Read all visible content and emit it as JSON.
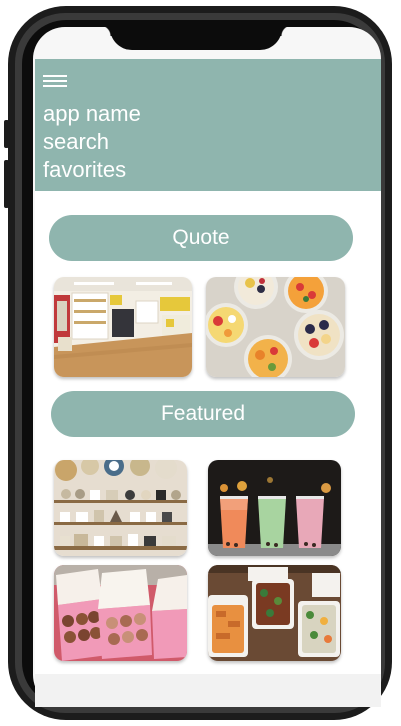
{
  "header": {
    "line1": "app name",
    "line2": "search",
    "line3": "favorites",
    "menu_icon": "hamburger-icon"
  },
  "sections": {
    "quote_label": "Quote",
    "featured_label": "Featured"
  },
  "colors": {
    "accent": "#8fb5ae",
    "header_text": "#ffffff",
    "phone_frame": "#1c1c1c"
  },
  "images": [
    "store-interior",
    "fruit-bowls",
    "pottery-shelves",
    "boba-drinks",
    "pastry-boxes",
    "takeout-meals"
  ]
}
